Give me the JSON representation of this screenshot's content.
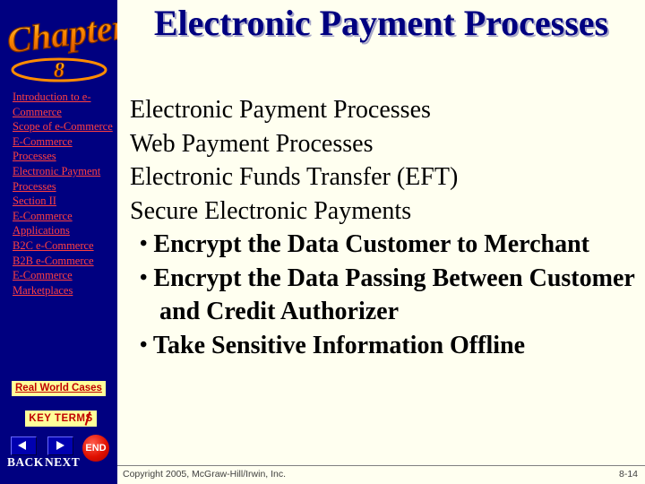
{
  "sidebar": {
    "chapter_banner": {
      "word": "Chapter",
      "number": "8"
    },
    "items": [
      {
        "label": "Introduction to e-Commerce"
      },
      {
        "label": "Scope of e-Commerce"
      },
      {
        "label": "E-Commerce Processes"
      },
      {
        "label": "Electronic Payment Processes"
      },
      {
        "label": "Section II"
      },
      {
        "label": "E-Commerce Applications"
      },
      {
        "label": "B2C e-Commerce"
      },
      {
        "label": "B2B e-Commerce"
      },
      {
        "label": "E-Commerce Marketplaces"
      }
    ],
    "real_world_cases": "Real World Cases",
    "key_terms": "KEY TERMS",
    "back_label": "BACK",
    "next_label": "NEXT",
    "end_label": "END"
  },
  "main": {
    "title": "Electronic Payment Processes",
    "lines": [
      {
        "level": 1,
        "text": "Electronic Payment Processes"
      },
      {
        "level": 1,
        "text": "Web Payment Processes"
      },
      {
        "level": 1,
        "text": "Electronic Funds Transfer (EFT)"
      },
      {
        "level": 1,
        "text": "Secure Electronic Payments"
      },
      {
        "level": 2,
        "text": "Encrypt the Data Customer to Merchant"
      },
      {
        "level": 2,
        "text": "Encrypt the Data Passing Between Customer and Credit Authorizer"
      },
      {
        "level": 2,
        "text": "Take Sensitive Information Offline"
      }
    ],
    "bullet_glyph": "•"
  },
  "footer": {
    "copyright": "Copyright 2005, McGraw-Hill/Irwin, Inc.",
    "page_number": "8-14"
  },
  "colors": {
    "sidebar_background": "#000080",
    "link": "#ff4040",
    "title": "#000080",
    "slide_background": "#fffff0",
    "highlight_background": "#ffff99",
    "highlight_text": "#c00000"
  }
}
